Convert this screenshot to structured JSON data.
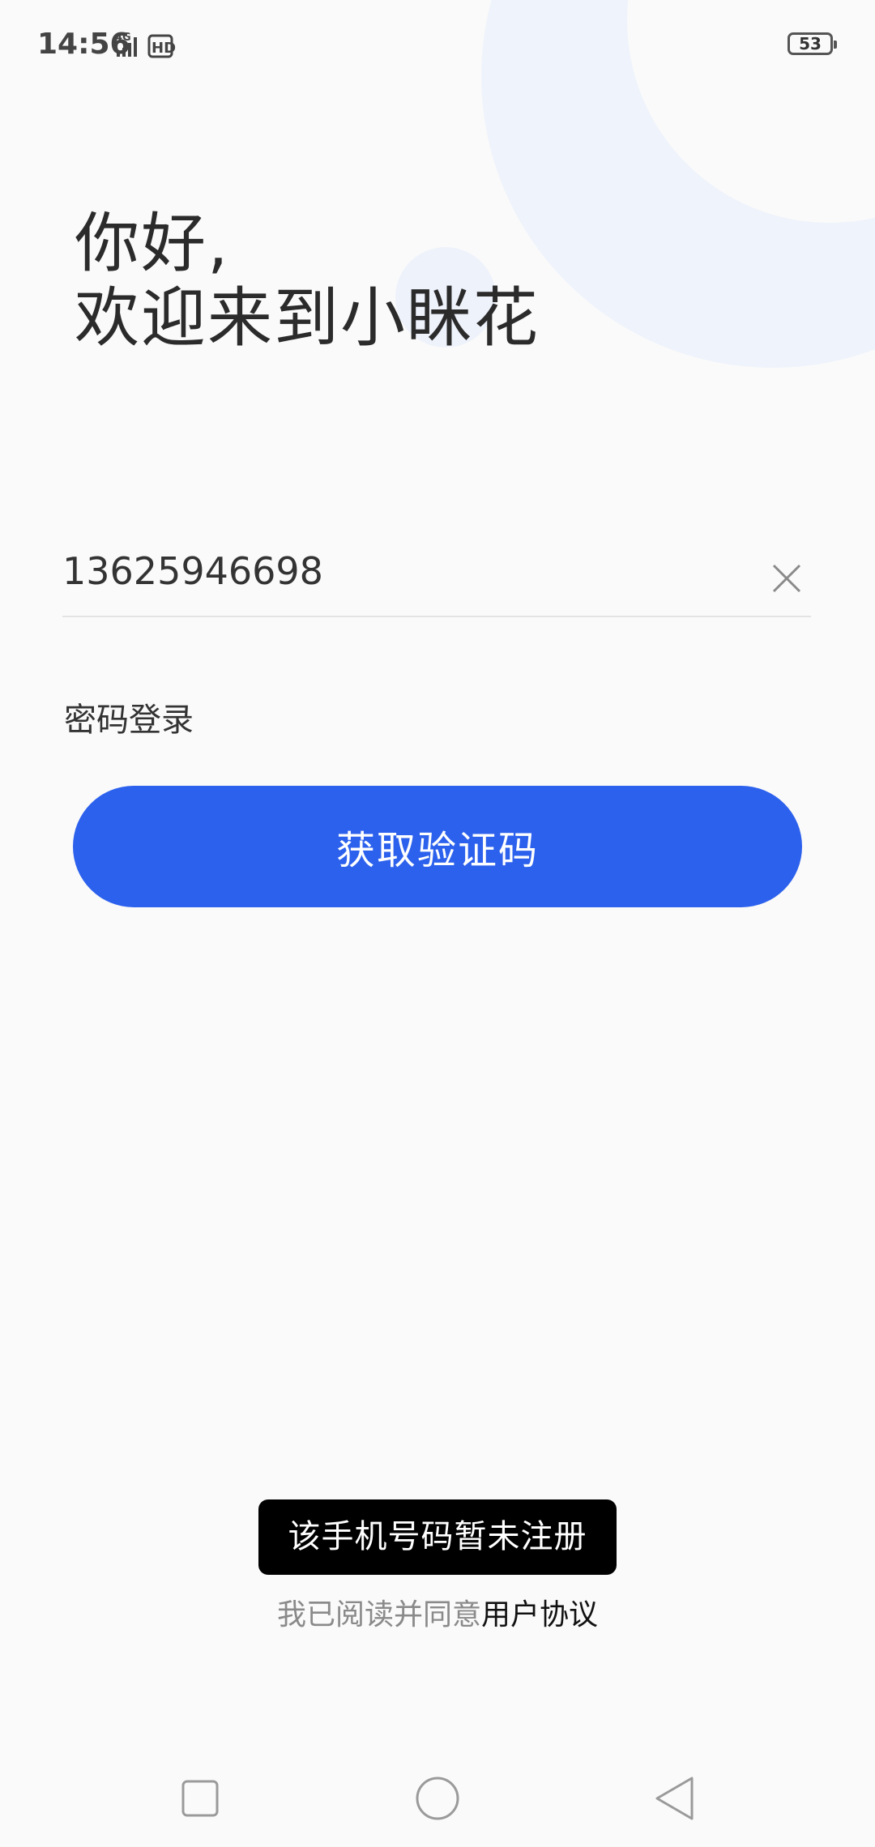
{
  "status_bar": {
    "time": "14:56",
    "battery": "53"
  },
  "greeting": {
    "line1": "你好,",
    "line2": "欢迎来到小眯花"
  },
  "phone": {
    "value": "13625946698"
  },
  "password_login_label": "密码登录",
  "get_code_button": "获取验证码",
  "toast_message": "该手机号码暂未注册",
  "agreement": {
    "text": "我已阅读并同意",
    "link": "用户协议"
  },
  "colors": {
    "primary": "#2c61ed",
    "background": "#fafafa",
    "deco": "#eff3fb",
    "toast_bg": "#000000"
  },
  "icons": {
    "clear": "close-icon",
    "nav_recent": "square-icon",
    "nav_home": "circle-icon",
    "nav_back": "triangle-back-icon"
  }
}
